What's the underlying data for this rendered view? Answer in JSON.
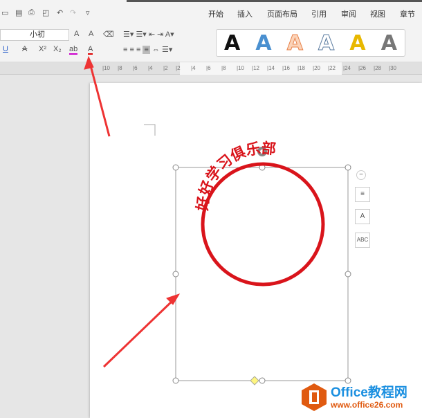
{
  "quick_access": [
    "save-icon",
    "export-pdf-icon",
    "print-icon",
    "print-preview-icon",
    "undo-icon",
    "redo-icon",
    "customize-icon"
  ],
  "tabs": [
    "开始",
    "插入",
    "页面布局",
    "引用",
    "审阅",
    "视图",
    "章节"
  ],
  "ribbon": {
    "font_size": "小初",
    "grow": "A",
    "shrink": "A",
    "underline": "U",
    "strike": "A",
    "superscript": "X²",
    "subscript": "X₂",
    "highlight": "ab",
    "font_color": "A"
  },
  "art_styles": [
    {
      "label": "A",
      "color": "#111111"
    },
    {
      "label": "A",
      "color": "#4a90d0"
    },
    {
      "label": "A",
      "color": "#f0a070"
    },
    {
      "label": "A",
      "color": "#ffffff"
    },
    {
      "label": "A",
      "color": "#e8b800"
    },
    {
      "label": "A",
      "color": "#777777"
    }
  ],
  "ruler_ticks": [
    "10",
    "8",
    "6",
    "4",
    "2",
    "2",
    "4",
    "6",
    "8",
    "10",
    "12",
    "14",
    "16",
    "18",
    "20",
    "22",
    "24",
    "26",
    "28",
    "30"
  ],
  "stamp": {
    "text": "好好学习俱乐部",
    "color": "#d9141b"
  },
  "side_tools": [
    "−",
    "≡",
    "A",
    "ABC"
  ],
  "logo": {
    "name": "Office教程网",
    "url": "www.office26.com"
  }
}
